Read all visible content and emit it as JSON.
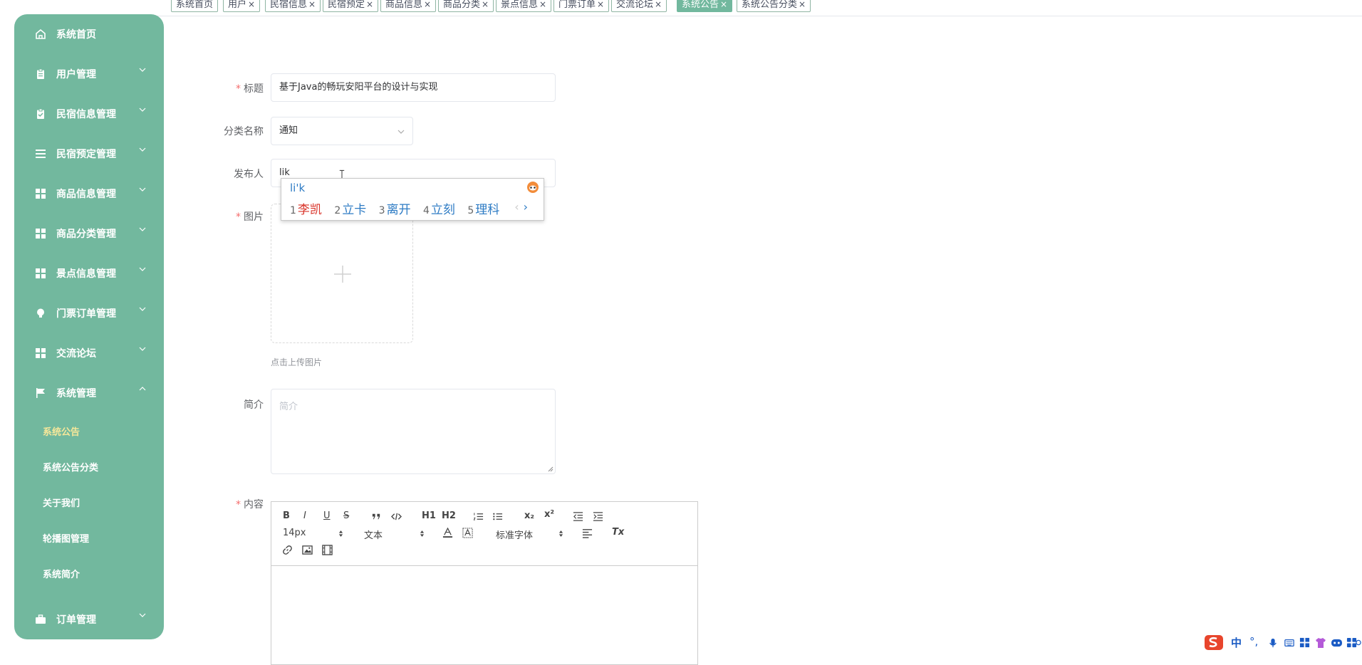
{
  "tabs": [
    {
      "label": "系统首页"
    },
    {
      "label": "用户"
    },
    {
      "label": "民宿信息"
    },
    {
      "label": "民宿预定"
    },
    {
      "label": "商品信息"
    },
    {
      "label": "商品分类"
    },
    {
      "label": "景点信息"
    },
    {
      "label": "门票订单"
    },
    {
      "label": "交流论坛"
    },
    {
      "label": "系统公告"
    },
    {
      "label": "系统公告分类"
    }
  ],
  "tab_close": "×",
  "sidebar": {
    "items": [
      {
        "label": "系统首页",
        "icon": "home-icon"
      },
      {
        "label": "用户管理",
        "icon": "clipboard-icon"
      },
      {
        "label": "民宿信息管理",
        "icon": "clipboard-check-icon"
      },
      {
        "label": "民宿预定管理",
        "icon": "list-icon"
      },
      {
        "label": "商品信息管理",
        "icon": "grid-icon"
      },
      {
        "label": "商品分类管理",
        "icon": "grid-icon"
      },
      {
        "label": "景点信息管理",
        "icon": "grid-icon"
      },
      {
        "label": "门票订单管理",
        "icon": "bulb-icon"
      },
      {
        "label": "交流论坛",
        "icon": "grid-icon"
      },
      {
        "label": "系统管理",
        "icon": "flag-icon"
      }
    ],
    "sub_items": [
      {
        "label": "系统公告"
      },
      {
        "label": "系统公告分类"
      },
      {
        "label": "关于我们"
      },
      {
        "label": "轮播图管理"
      },
      {
        "label": "系统简介"
      }
    ],
    "last_item": {
      "label": "订单管理",
      "icon": "briefcase-icon"
    },
    "colors": {
      "bg": "#72b89e",
      "active_sub": "#f6e79a"
    }
  },
  "form": {
    "title_label": "标题",
    "title_value": "基于Java的畅玩安阳平台的设计与实现",
    "category_label": "分类名称",
    "category_value": "通知",
    "publisher_label": "发布人",
    "publisher_value": "lik",
    "image_label": "图片",
    "upload_hint": "点击上传图片",
    "summary_label": "简介",
    "summary_placeholder": "简介",
    "content_label": "内容",
    "required_mark": "*"
  },
  "ime": {
    "composition": "li'k",
    "candidates": [
      {
        "n": "1",
        "text": "李凯"
      },
      {
        "n": "2",
        "text": "立卡"
      },
      {
        "n": "3",
        "text": "离开"
      },
      {
        "n": "4",
        "text": "立刻"
      },
      {
        "n": "5",
        "text": "理科"
      }
    ],
    "prev": "‹",
    "next": "›"
  },
  "editor": {
    "size_value": "14px",
    "header_value": "文本",
    "font_value": "标准字体",
    "buttons": {
      "bold": "B",
      "italic": "I",
      "underline": "U",
      "strike": "S",
      "h1": "H1",
      "h2": "H2",
      "sub": "x₂",
      "sup": "x²",
      "clean": "Tx"
    }
  },
  "tray": {
    "ime_mode": "中",
    "punct": "°,"
  }
}
